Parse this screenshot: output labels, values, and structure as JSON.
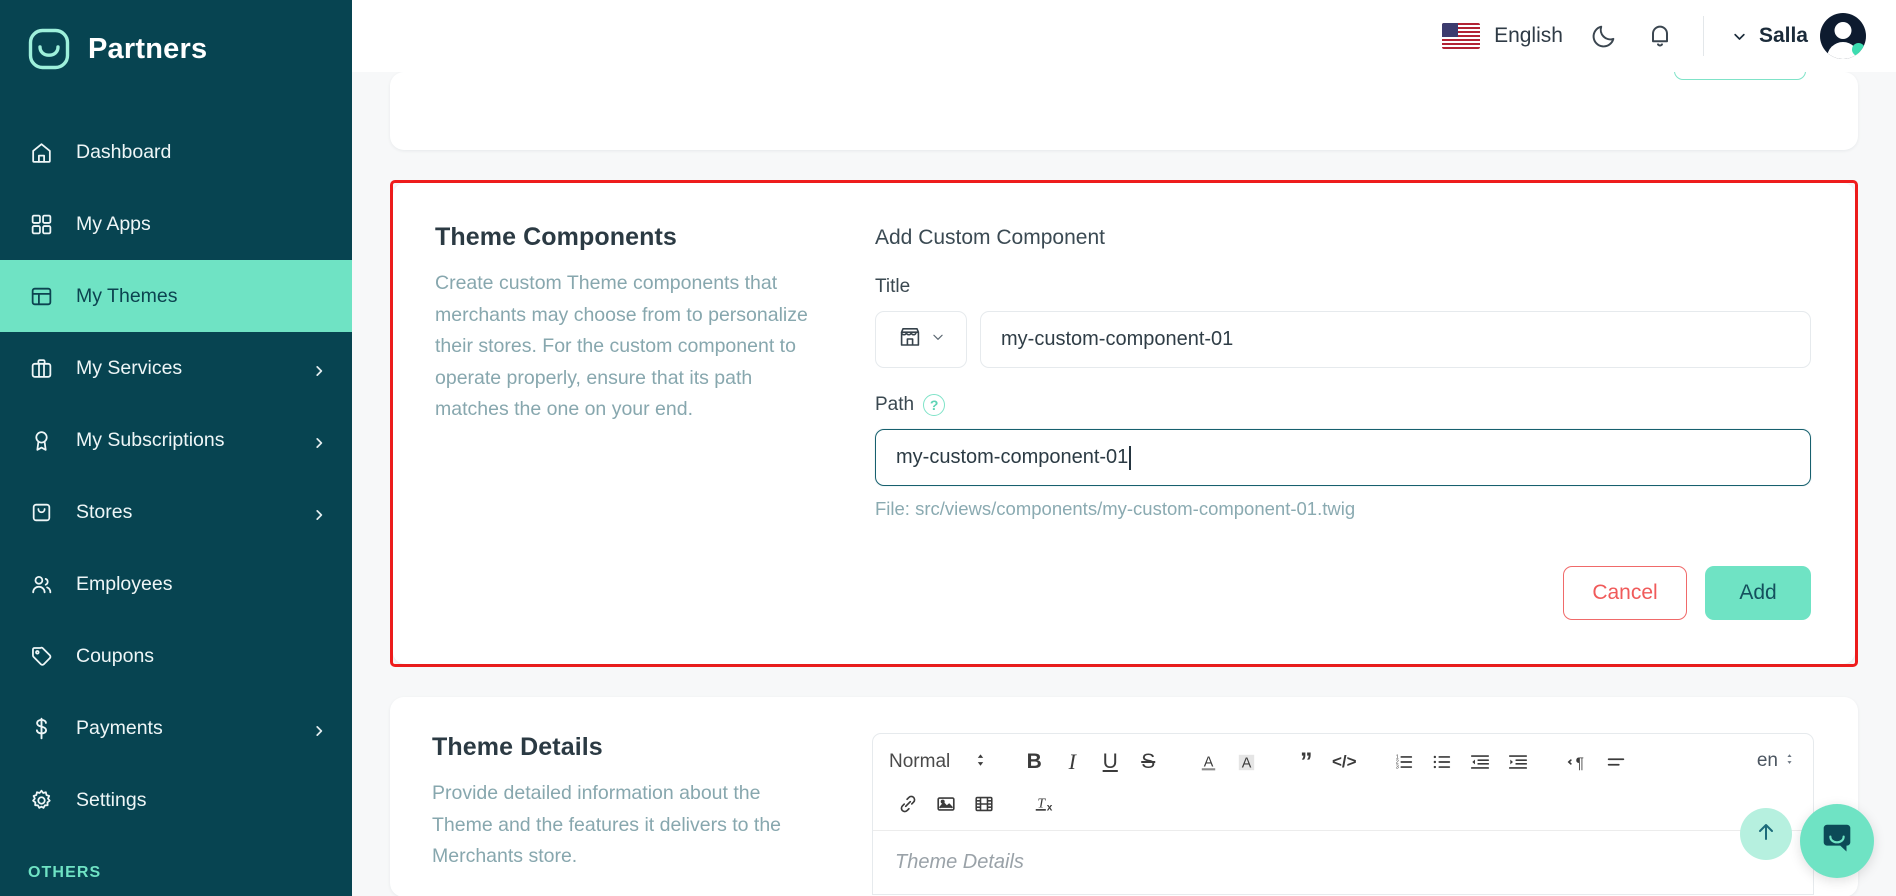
{
  "brand": {
    "name": "Partners",
    "logo_icon": "salla-smile-logo-icon"
  },
  "sidebar": {
    "items": [
      {
        "label": "Dashboard",
        "icon": "home-icon",
        "has_chevron": false,
        "active": false
      },
      {
        "label": "My Apps",
        "icon": "grid-apps-icon",
        "has_chevron": false,
        "active": false
      },
      {
        "label": "My Themes",
        "icon": "layout-theme-icon",
        "has_chevron": false,
        "active": true
      },
      {
        "label": "My Services",
        "icon": "briefcase-icon",
        "has_chevron": true,
        "active": false
      },
      {
        "label": "My Subscriptions",
        "icon": "badge-ribbon-icon",
        "has_chevron": true,
        "active": false
      },
      {
        "label": "Stores",
        "icon": "shopping-bag-icon",
        "has_chevron": true,
        "active": false
      },
      {
        "label": "Employees",
        "icon": "users-icon",
        "has_chevron": false,
        "active": false
      },
      {
        "label": "Coupons",
        "icon": "tag-icon",
        "has_chevron": false,
        "active": false
      },
      {
        "label": "Payments",
        "icon": "dollar-icon",
        "has_chevron": true,
        "active": false
      },
      {
        "label": "Settings",
        "icon": "gear-icon",
        "has_chevron": false,
        "active": false
      }
    ],
    "section_label": "OTHERS",
    "active_bg": "#6fe3c4",
    "bg": "#074451"
  },
  "topbar": {
    "language": "English",
    "flag_icon": "us-flag-icon",
    "dark_mode_icon": "moon-icon",
    "notifications_icon": "bell-icon",
    "user_name": "Salla",
    "user_chevron_icon": "chevron-down-icon",
    "avatar_icon": "user-avatar",
    "status_color": "#3ddcb0"
  },
  "theme_components": {
    "title": "Theme Components",
    "description": "Create custom Theme components that merchants may choose from to personalize their stores. For the custom component to operate properly, ensure that its path matches the one on your end.",
    "form_title": "Add Custom Component",
    "title_label": "Title",
    "icon_picker": {
      "icon": "storefront-icon",
      "chevron": "chevron-down-icon"
    },
    "title_value": "my-custom-component-01",
    "path_label": "Path",
    "help_icon": "question-mark-icon",
    "path_value": "my-custom-component-01",
    "file_hint": "File: src/views/components/my-custom-component-01.twig",
    "cancel_label": "Cancel",
    "add_label": "Add",
    "highlight_color": "#ef1c1c",
    "accent_color": "#6fe3c4",
    "cancel_color": "#f05a5a"
  },
  "theme_details": {
    "title": "Theme Details",
    "description": "Provide detailed information about the Theme and the features it delivers to the Merchants store.",
    "editor": {
      "format_value": "Normal",
      "lang_badge": "en",
      "placeholder": "Theme Details",
      "toolbar_row1": [
        {
          "name": "bold-icon",
          "glyph": "B"
        },
        {
          "name": "italic-icon",
          "glyph": "I"
        },
        {
          "name": "underline-icon",
          "glyph": "U"
        },
        {
          "name": "strikethrough-icon",
          "glyph": "S"
        },
        {
          "name": "text-color-icon",
          "glyph": "A"
        },
        {
          "name": "highlight-color-icon",
          "glyph": "A"
        },
        {
          "name": "blockquote-icon",
          "glyph": "”"
        },
        {
          "name": "code-block-icon",
          "glyph": "</>"
        },
        {
          "name": "ordered-list-icon",
          "glyph": "1."
        },
        {
          "name": "bullet-list-icon",
          "glyph": "•"
        },
        {
          "name": "outdent-icon",
          "glyph": "←"
        },
        {
          "name": "indent-icon",
          "glyph": "→"
        },
        {
          "name": "text-direction-icon",
          "glyph": "¶"
        },
        {
          "name": "align-icon",
          "glyph": "≡"
        }
      ],
      "toolbar_row2": [
        {
          "name": "link-icon",
          "glyph": "ὑ7"
        },
        {
          "name": "image-icon",
          "glyph": "ὛC"
        },
        {
          "name": "video-icon",
          "glyph": "ἹE"
        },
        {
          "name": "clear-format-icon",
          "glyph": "Tx"
        }
      ]
    }
  },
  "floating": {
    "scroll_top_icon": "arrow-up-icon",
    "chat_icon": "chat-bubble-icon",
    "scroll_top_bg": "#b6f0df",
    "chat_bg": "#6fe3c4"
  }
}
